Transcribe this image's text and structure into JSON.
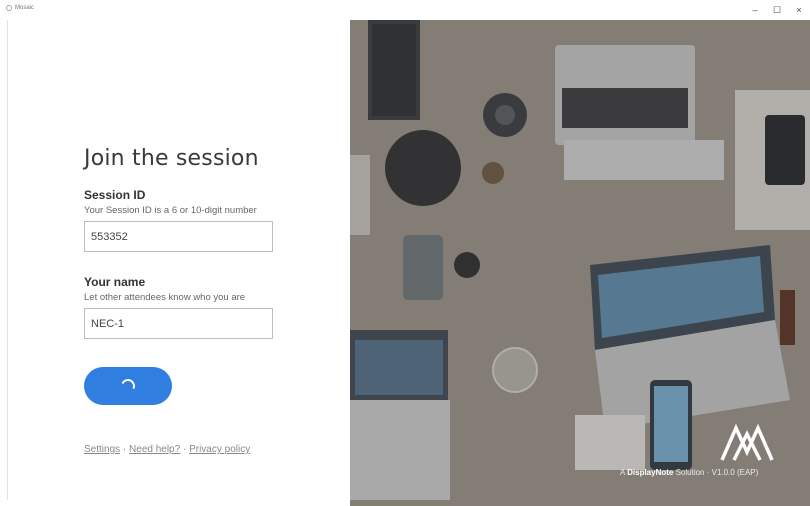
{
  "window": {
    "app_title": "Mosaic",
    "minimize": "–",
    "maximize": "☐",
    "close": "×"
  },
  "form": {
    "heading": "Join the session",
    "session_id": {
      "label": "Session ID",
      "hint": "Your Session ID is a 6 or 10-digit number",
      "value": "553352"
    },
    "name": {
      "label": "Your name",
      "hint": "Let other attendees know who you are",
      "value": "NEC-1"
    },
    "join_button_state": "loading"
  },
  "footer": {
    "settings": "Settings",
    "sep1": " · ",
    "help": "Need help?",
    "sep2": " · ",
    "privacy": "Privacy policy"
  },
  "brand": {
    "prefix": "A ",
    "name": "DisplayNote",
    "suffix": " Solution · V1.0.0 (EAP)"
  },
  "colors": {
    "accent": "#2f7ee0"
  }
}
